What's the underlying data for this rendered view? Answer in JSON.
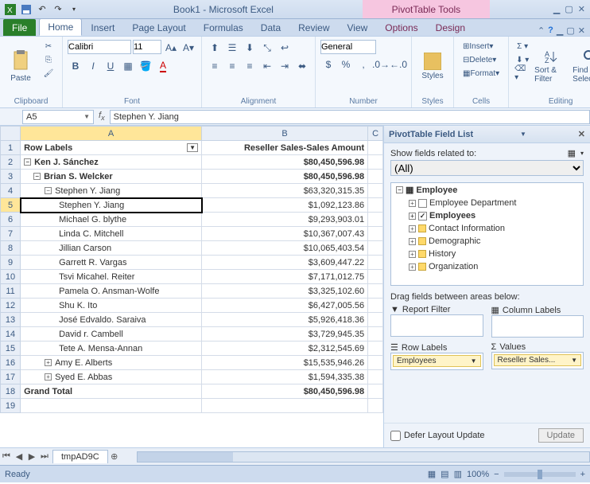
{
  "title": "Book1 - Microsoft Excel",
  "tools_tab": "PivotTable Tools",
  "tabs": {
    "file": "File",
    "home": "Home",
    "insert": "Insert",
    "pagelayout": "Page Layout",
    "formulas": "Formulas",
    "data": "Data",
    "review": "Review",
    "view": "View",
    "options": "Options",
    "design": "Design"
  },
  "ribbon": {
    "clipboard": "Clipboard",
    "paste": "Paste",
    "font": "Font",
    "font_name": "Calibri",
    "font_size": "11",
    "alignment": "Alignment",
    "number": "Number",
    "number_fmt": "General",
    "styles": "Styles",
    "cells": "Cells",
    "insert": "Insert",
    "delete": "Delete",
    "format": "Format",
    "editing": "Editing",
    "sort": "Sort & Filter",
    "find": "Find & Select"
  },
  "namebox": "A5",
  "formula": "Stephen Y. Jiang",
  "cols": {
    "A": "A",
    "B": "B",
    "C": "C"
  },
  "rows": [
    "1",
    "2",
    "3",
    "4",
    "5",
    "6",
    "7",
    "8",
    "9",
    "10",
    "11",
    "12",
    "13",
    "14",
    "15",
    "16",
    "17",
    "18",
    "19"
  ],
  "cells": {
    "hdr_rowlabels": "Row Labels",
    "hdr_amount": "Reseller Sales-Sales Amount",
    "r2a": "Ken J. Sánchez",
    "r2b": "$80,450,596.98",
    "r3a": "Brian S. Welcker",
    "r3b": "$80,450,596.98",
    "r4a": "Stephen Y. Jiang",
    "r4b": "$63,320,315.35",
    "r5a": "Stephen Y. Jiang",
    "r5b": "$1,092,123.86",
    "r6a": "Michael G. blythe",
    "r6b": "$9,293,903.01",
    "r7a": "Linda C. Mitchell",
    "r7b": "$10,367,007.43",
    "r8a": "Jillian Carson",
    "r8b": "$10,065,403.54",
    "r9a": "Garrett R. Vargas",
    "r9b": "$3,609,447.22",
    "r10a": "Tsvi Micahel. Reiter",
    "r10b": "$7,171,012.75",
    "r11a": "Pamela O. Ansman-Wolfe",
    "r11b": "$3,325,102.60",
    "r12a": "Shu K. Ito",
    "r12b": "$6,427,005.56",
    "r13a": "José Edvaldo. Saraiva",
    "r13b": "$5,926,418.36",
    "r14a": "David r. Cambell",
    "r14b": "$3,729,945.35",
    "r15a": "Tete A. Mensa-Annan",
    "r15b": "$2,312,545.69",
    "r16a": "Amy E. Alberts",
    "r16b": "$15,535,946.26",
    "r17a": "Syed E. Abbas",
    "r17b": "$1,594,335.38",
    "r18a": "Grand Total",
    "r18b": "$80,450,596.98"
  },
  "taskpane": {
    "title": "PivotTable Field List",
    "show_fields": "Show fields related to:",
    "show_all": "(All)",
    "employee": "Employee",
    "emp_dept": "Employee Department",
    "employees": "Employees",
    "contact": "Contact Information",
    "demographic": "Demographic",
    "history": "History",
    "organization": "Organization",
    "drag": "Drag fields between areas below:",
    "report_filter": "Report Filter",
    "col_labels": "Column Labels",
    "row_labels": "Row Labels",
    "values": "Values",
    "pill_rows": "Employees",
    "pill_vals": "Reseller Sales...",
    "defer": "Defer Layout Update",
    "update": "Update"
  },
  "sheet_tab": "tmpAD9C",
  "status": {
    "ready": "Ready",
    "zoom": "100%"
  }
}
